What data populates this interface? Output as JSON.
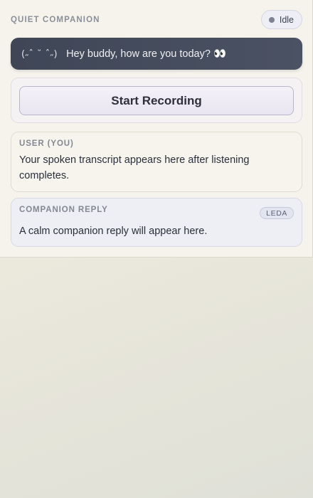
{
  "header": {
    "title": "QUIET COMPANION",
    "status": "Idle"
  },
  "speech": {
    "kaomoji": "(˶ˆ ˘ ˆ˶)",
    "text": "Hey buddy, how are you today? 👀"
  },
  "controls": {
    "record_label": "Start Recording"
  },
  "user_card": {
    "label": "USER (YOU)",
    "body": "Your spoken transcript appears here after listening completes."
  },
  "reply_card": {
    "label": "COMPANION REPLY",
    "badge": "LEDA",
    "body": "A calm companion reply will appear here."
  },
  "colors": {
    "bubble": "#434a5a",
    "status_dot": "#7d8190",
    "background": "#ebe8dc"
  }
}
